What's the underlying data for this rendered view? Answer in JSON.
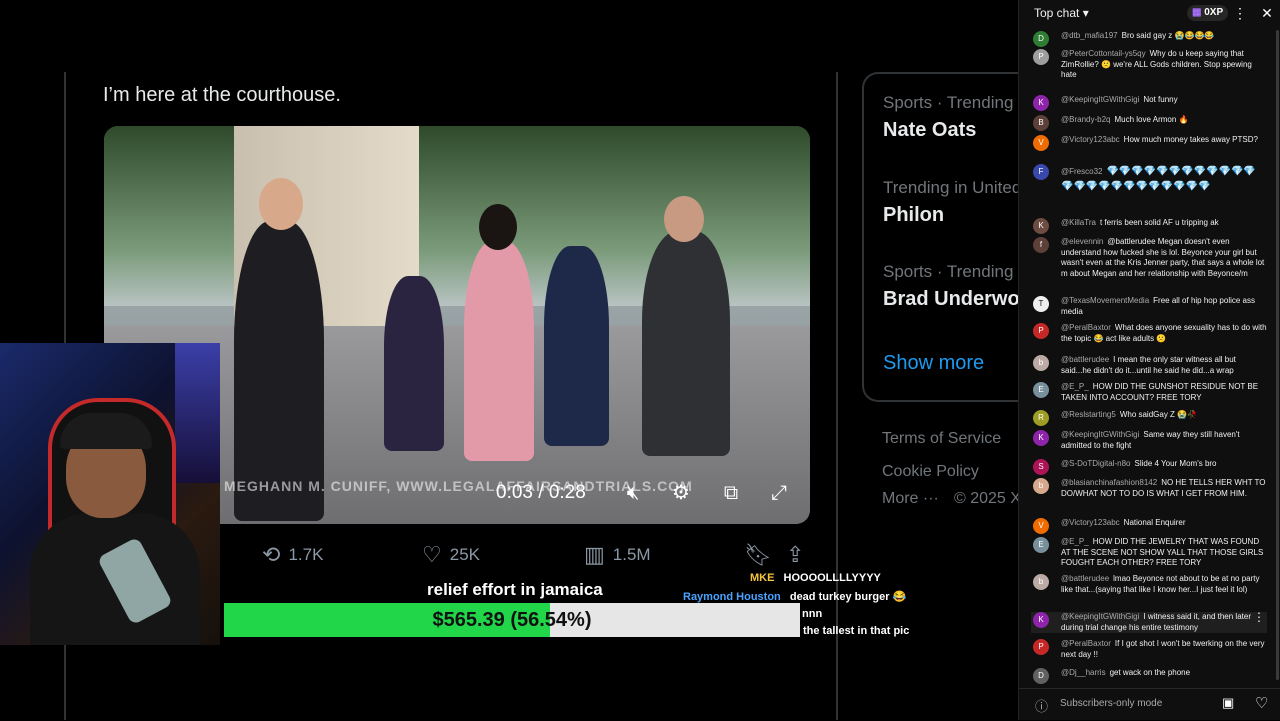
{
  "tweet": {
    "text": "I’m here at the courthouse.",
    "video": {
      "watermark": "MEGHANN M. CUNIFF, WWW.LEGALAFFAIRSANDTRIALS.COM",
      "time": "0:03 / 0:28",
      "progress": 0.107
    },
    "actions": {
      "retweets": "1.7K",
      "likes": "25K",
      "views": "1.5M"
    }
  },
  "trends": [
    {
      "category": "Sports · Trending",
      "name": "Nate Oats"
    },
    {
      "category": "Trending in United States",
      "name": "Philon"
    },
    {
      "category": "Sports · Trending",
      "name": "Brad Underwood"
    }
  ],
  "show_more": "Show more",
  "footer_links": {
    "terms": "Terms of Service",
    "cookie": "Cookie Policy",
    "more": "More ···",
    "copyright": "© 2025 X"
  },
  "donation": {
    "title": "relief effort in jamaica",
    "amount_text": "$565.39 (56.54%)",
    "percent": 56.54
  },
  "overlay_chat": [
    {
      "name": "MKE",
      "text": "HOOOOLLLLYYYY",
      "color": "#f5c542"
    },
    {
      "name": "Raymond Houston",
      "text": "dead turkey burger 😂",
      "color": "#4aa3ff"
    },
    {
      "name": "",
      "text": "nnn",
      "color": "#cccccc"
    },
    {
      "name": "",
      "text": "the tallest in that pic",
      "color": "#cccccc"
    }
  ],
  "chat": {
    "header_label": "Top chat",
    "xp_label": "0XP",
    "footer_label": "Subscribers-only mode",
    "messages": [
      {
        "author": "@dtb_mafia197",
        "text": "Bro said gay z 😭😂😂😂",
        "avatar": "D",
        "color": "#2e7d32"
      },
      {
        "author": "@PeterCottontail-ys5qy",
        "text": "Why do u keep saying that ZimRollie? 🙁 we're ALL Gods children. Stop spewing hate",
        "avatar": "P",
        "color": "#9e9e9e"
      },
      {
        "author": "@KeepingItGWithGigi",
        "text": "Not funny",
        "avatar": "K",
        "color": "#8e24aa"
      },
      {
        "author": "@Brandy-b2q",
        "text": "Much love Armon 🔥",
        "avatar": "B",
        "color": "#5d4037"
      },
      {
        "author": "@Victory123abc",
        "text": "How much money takes away PTSD?",
        "avatar": "V",
        "color": "#ef6c00"
      },
      {
        "author": "@Fresco32",
        "text": "💎💎💎💎💎💎💎💎💎💎💎💎💎💎💎💎💎💎💎💎💎💎💎💎",
        "avatar": "F",
        "color": "#3949ab"
      },
      {
        "author": "@KillaTra",
        "text": "t ferris been solid AF u tripping ak",
        "avatar": "K",
        "color": "#6d4c41"
      },
      {
        "author": "@elevennin",
        "text": "@battlerudee Megan doesn't even understand how fucked she is lol. Beyonce your girl but wasn't even at the Kris Jenner party, that says a whole lot m about Megan and her relationship with Beyonce/m",
        "avatar": "f",
        "color": "#5d4037"
      },
      {
        "author": "@TexasMovementMedia",
        "text": "Free all of hip hop police ass media",
        "avatar": "T",
        "color": "#eeeeee"
      },
      {
        "author": "@PeralBaxtor",
        "text": "What does anyone sexuality has to do with the topic 😂 act like adults 🙁",
        "avatar": "P",
        "color": "#c62828"
      },
      {
        "author": "@battlerudee",
        "text": "I mean the only star witness all but said...he didn't do it...until he said he did...a wrap",
        "avatar": "b",
        "color": "#bcaaa4"
      },
      {
        "author": "@E_P_",
        "text": "HOW DID THE GUNSHOT RESIDUE NOT BE TAKEN INTO ACCOUNT? FREE TORY",
        "avatar": "E",
        "color": "#78909c"
      },
      {
        "author": "@Reslstarting5",
        "text": "Who saidGay Z 😭🥀",
        "avatar": "R",
        "color": "#9e9d24"
      },
      {
        "author": "@KeepingItGWithGigi",
        "text": "Same way they still haven't admitted to the fight",
        "avatar": "K",
        "color": "#8e24aa"
      },
      {
        "author": "@S-DoTDigital-n8o",
        "text": "Slide 4 Your Mom's bro",
        "avatar": "S",
        "color": "#ad1457"
      },
      {
        "author": "@blasianchinafashion8142",
        "text": "NO HE TELLS HER WHT TO DO/WHAT NOT TO DO IS WHAT I GET FROM HIM.",
        "avatar": "b",
        "color": "#d7a98c"
      },
      {
        "author": "@Victory123abc",
        "text": "National Enquirer",
        "avatar": "V",
        "color": "#ef6c00"
      },
      {
        "author": "@E_P_",
        "text": "HOW DID THE JEWELRY THAT WAS FOUND AT THE SCENE NOT SHOW YALL THAT THOSE GIRLS FOUGHT EACH OTHER? FREE TORY",
        "avatar": "E",
        "color": "#78909c"
      },
      {
        "author": "@battlerudee",
        "text": "lmao Beyonce not about to be at no party like that...(saying that like I know her...I just feel it lol)",
        "avatar": "b",
        "color": "#bcaaa4"
      },
      {
        "author": "@KeepingItGWithGigi",
        "text": "I witness said it, and then later during trial change his entire testimony",
        "avatar": "K",
        "color": "#8e24aa"
      },
      {
        "author": "@PeralBaxtor",
        "text": "If I got shot I won't be twerking on the very next day !!",
        "avatar": "P",
        "color": "#c62828"
      },
      {
        "author": "@Dj__harris",
        "text": "get wack on the phone",
        "avatar": "D",
        "color": "#616161"
      }
    ]
  }
}
